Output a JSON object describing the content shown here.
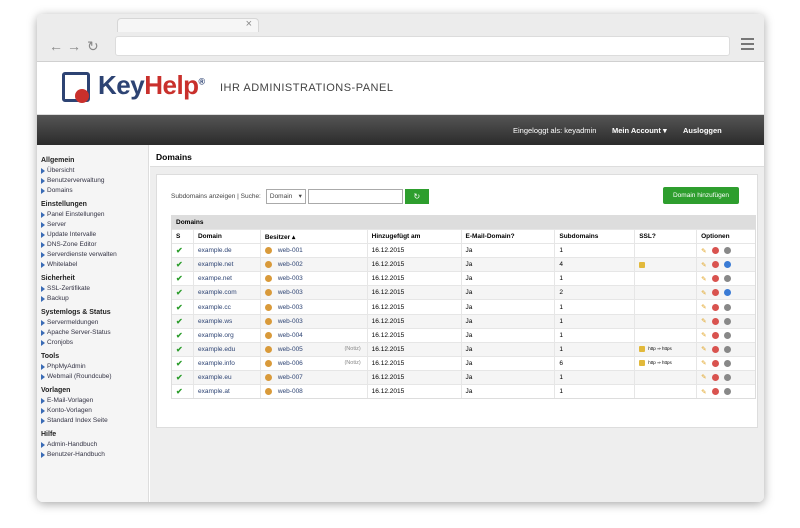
{
  "browser": {
    "tab_close": "×",
    "back": "←",
    "forward": "→",
    "reload": "↻"
  },
  "brand": {
    "key": "Key",
    "help": "Help",
    "reg": "®",
    "subtitle": "IHR ADMINISTRATIONS-PANEL"
  },
  "topbar": {
    "logged_in": "Eingeloggt als: keyadmin",
    "account": "Mein Account ▾",
    "logout": "Ausloggen"
  },
  "sidebar": [
    {
      "title": "Allgemein",
      "items": [
        "Übersicht",
        "Benutzerverwaltung",
        "Domains"
      ]
    },
    {
      "title": "Einstellungen",
      "items": [
        "Panel Einstellungen",
        "Server",
        "Update Intervalle",
        "DNS-Zone Editor",
        "Serverdienste verwalten",
        "Whitelabel"
      ]
    },
    {
      "title": "Sicherheit",
      "items": [
        "SSL-Zertifikate",
        "Backup"
      ]
    },
    {
      "title": "Systemlogs & Status",
      "items": [
        "Servermeldungen",
        "Apache Server-Status",
        "Cronjobs"
      ]
    },
    {
      "title": "Tools",
      "items": [
        "PhpMyAdmin",
        "Webmail (Roundcube)"
      ]
    },
    {
      "title": "Vorlagen",
      "items": [
        "E-Mail-Vorlagen",
        "Konto-Vorlagen",
        "Standard Index Seite"
      ]
    },
    {
      "title": "Hilfe",
      "items": [
        "Admin-Handbuch",
        "Benutzer-Handbuch"
      ]
    }
  ],
  "main": {
    "title": "Domains",
    "filter_label": "Subdomains anzeigen | Suche:",
    "select_value": "Domain",
    "go_icon": "↻",
    "add_button": "Domain hinzufügen",
    "table_title": "Domains",
    "columns": [
      "S",
      "Domain",
      "Besitzer ▴",
      "Hinzugefügt am",
      "E-Mail-Domain?",
      "Subdomains",
      "SSL?",
      "Optionen"
    ],
    "rows": [
      {
        "s": "✔",
        "domain": "example.de",
        "owner": "web-001",
        "note": "",
        "added": "16.12.2015",
        "email": "Ja",
        "subs": "1",
        "ssl": "",
        "globe": "grey"
      },
      {
        "s": "✔",
        "domain": "example.net",
        "owner": "web-002",
        "note": "",
        "added": "16.12.2015",
        "email": "Ja",
        "subs": "4",
        "ssl": "lock",
        "globe": "blue"
      },
      {
        "s": "✔",
        "domain": "exampe.net",
        "owner": "web-003",
        "note": "",
        "added": "16.12.2015",
        "email": "Ja",
        "subs": "1",
        "ssl": "",
        "globe": "grey"
      },
      {
        "s": "✔",
        "domain": "example.com",
        "owner": "web-003",
        "note": "",
        "added": "16.12.2015",
        "email": "Ja",
        "subs": "2",
        "ssl": "",
        "globe": "blue"
      },
      {
        "s": "✔",
        "domain": "example.cc",
        "owner": "web-003",
        "note": "",
        "added": "16.12.2015",
        "email": "Ja",
        "subs": "1",
        "ssl": "",
        "globe": "grey"
      },
      {
        "s": "✔",
        "domain": "example.ws",
        "owner": "web-003",
        "note": "",
        "added": "16.12.2015",
        "email": "Ja",
        "subs": "1",
        "ssl": "",
        "globe": "grey"
      },
      {
        "s": "✔",
        "domain": "example.org",
        "owner": "web-004",
        "note": "",
        "added": "16.12.2015",
        "email": "Ja",
        "subs": "1",
        "ssl": "",
        "globe": "grey"
      },
      {
        "s": "✔",
        "domain": "example.edu",
        "owner": "web-005",
        "note": "(Notiz)",
        "added": "16.12.2015",
        "email": "Ja",
        "subs": "1",
        "ssl": "http ⇒ https",
        "globe": "grey"
      },
      {
        "s": "✔",
        "domain": "example.info",
        "owner": "web-006",
        "note": "(Notiz)",
        "added": "16.12.2015",
        "email": "Ja",
        "subs": "6",
        "ssl": "http ⇒ https",
        "globe": "grey"
      },
      {
        "s": "✔",
        "domain": "example.eu",
        "owner": "web-007",
        "note": "",
        "added": "16.12.2015",
        "email": "Ja",
        "subs": "1",
        "ssl": "",
        "globe": "grey"
      },
      {
        "s": "✔",
        "domain": "example.at",
        "owner": "web-008",
        "note": "",
        "added": "16.12.2015",
        "email": "Ja",
        "subs": "1",
        "ssl": "",
        "globe": "grey"
      }
    ]
  }
}
